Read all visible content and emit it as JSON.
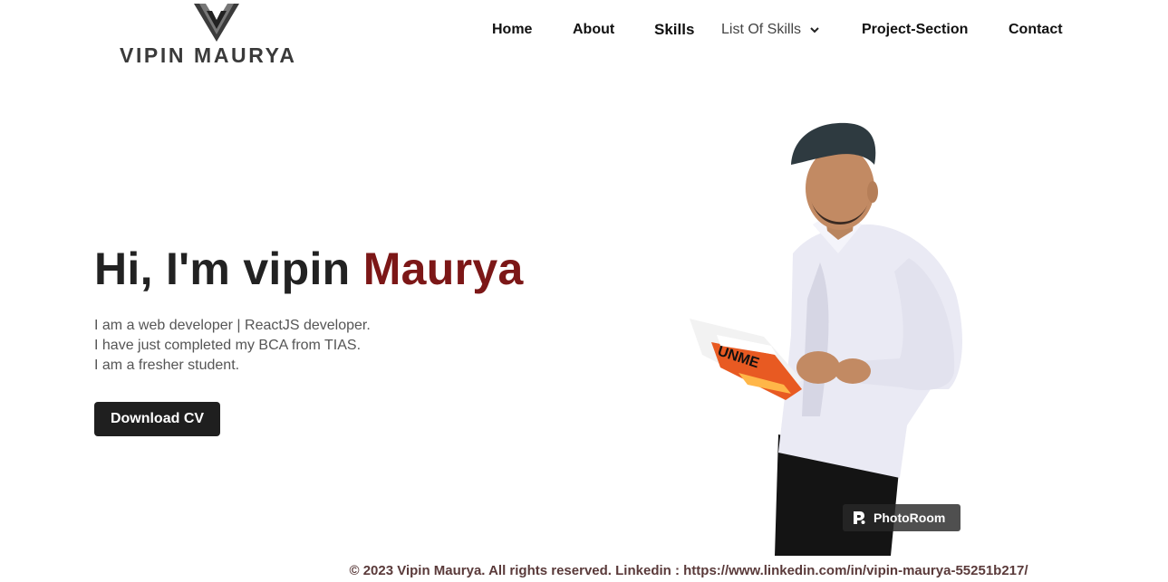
{
  "logo": {
    "text": "VIPIN MAURYA"
  },
  "nav": {
    "home": "Home",
    "about": "About",
    "skills": "Skills",
    "list_of_skills": "List Of Skills",
    "project_section": "Project-Section",
    "contact": "Contact"
  },
  "hero": {
    "greeting": "Hi, I'm vipin ",
    "name_accent": "Maurya",
    "lines": [
      "I am a web developer | ReactJS developer.",
      "I have just completed my BCA from TIAS.",
      "I am a fresher student."
    ],
    "download_cv": "Download CV"
  },
  "image": {
    "book_title": "UNME",
    "watermark": "PhotoRoom"
  },
  "footer": {
    "text": "© 2023 Vipin Maurya. All rights reserved. Linkedin : https://www.linkedin.com/in/vipin-maurya-55251b217/"
  },
  "colors": {
    "accent": "#7c1717",
    "button_bg": "#1f1f1f",
    "text": "#222222"
  }
}
